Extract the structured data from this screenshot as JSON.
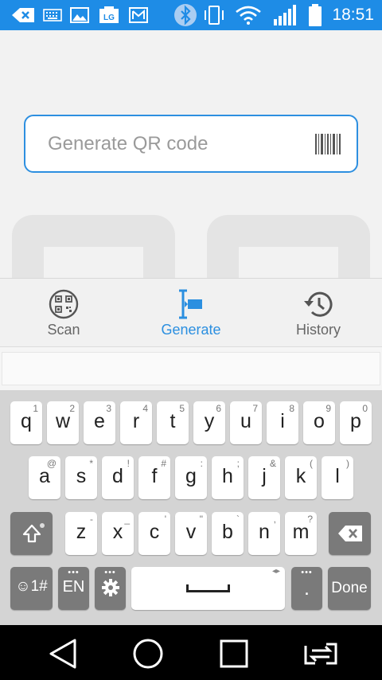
{
  "status_bar": {
    "time": "18:51",
    "icons": [
      "back-arrow-icon",
      "keyboard-icon",
      "image-icon",
      "lg-icon",
      "mail-icon",
      "bluetooth-icon",
      "vibrate-icon",
      "wifi-icon",
      "signal-icon",
      "battery-icon"
    ],
    "lg_text": "LG",
    "background": "#1e8ce6"
  },
  "input": {
    "placeholder": "Generate QR code"
  },
  "bottom_nav": {
    "items": [
      {
        "label": "Scan",
        "icon": "qr-scan-icon",
        "active": false
      },
      {
        "label": "Generate",
        "icon": "generate-icon",
        "active": true
      },
      {
        "label": "History",
        "icon": "history-icon",
        "active": false
      }
    ],
    "active_color": "#2b8fe0"
  },
  "keyboard": {
    "row1": [
      {
        "key": "q",
        "hint": "1"
      },
      {
        "key": "w",
        "hint": "2"
      },
      {
        "key": "e",
        "hint": "3"
      },
      {
        "key": "r",
        "hint": "4"
      },
      {
        "key": "t",
        "hint": "5"
      },
      {
        "key": "y",
        "hint": "6"
      },
      {
        "key": "u",
        "hint": "7"
      },
      {
        "key": "i",
        "hint": "8"
      },
      {
        "key": "o",
        "hint": "9"
      },
      {
        "key": "p",
        "hint": "0"
      }
    ],
    "row2": [
      {
        "key": "a",
        "hint": "@"
      },
      {
        "key": "s",
        "hint": "*"
      },
      {
        "key": "d",
        "hint": "!"
      },
      {
        "key": "f",
        "hint": "#"
      },
      {
        "key": "g",
        "hint": ":"
      },
      {
        "key": "h",
        "hint": ";"
      },
      {
        "key": "j",
        "hint": "&"
      },
      {
        "key": "k",
        "hint": "("
      },
      {
        "key": "l",
        "hint": ")"
      }
    ],
    "row3": [
      {
        "key": "z",
        "hint": "-"
      },
      {
        "key": "x",
        "hint": "_"
      },
      {
        "key": "c",
        "hint": "'"
      },
      {
        "key": "v",
        "hint": "\""
      },
      {
        "key": "b",
        "hint": "`"
      },
      {
        "key": "n",
        "hint": ","
      },
      {
        "key": "m",
        "hint": "?"
      }
    ],
    "emoji_label": "☺1#",
    "lang_label": "EN",
    "period_label": ".",
    "done_label": "Done"
  },
  "system_nav": {
    "icons": [
      "back-triangle-icon",
      "home-circle-icon",
      "recents-square-icon",
      "switch-icon"
    ]
  }
}
